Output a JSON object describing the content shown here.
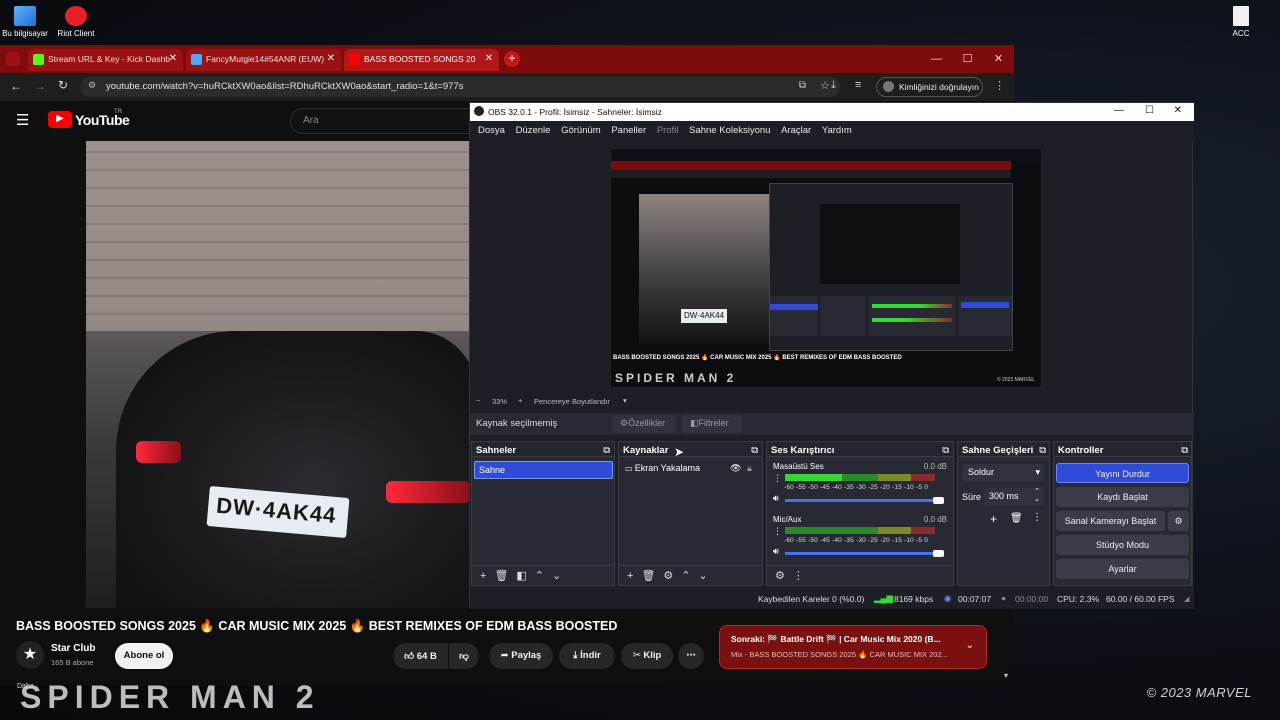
{
  "desktop": {
    "icons": [
      {
        "label": "Bu bilgisayar"
      },
      {
        "label": "Riot Client"
      },
      {
        "label": "ACC"
      }
    ],
    "wallpaper_text": "© 2023 MARVEL",
    "wallpaper_title": "SPIDER MAN 2"
  },
  "browser": {
    "tabs": [
      {
        "label": "Stream URL & Key - Kick Dashb",
        "color": "#53fc18"
      },
      {
        "label": "FancyMutgie14#54ANR (EUW)",
        "color": "#4aa8ff"
      },
      {
        "label": "BASS BOOSTED SONGS 20",
        "color": "#ff0000"
      }
    ],
    "url": "youtube.com/watch?v=huRCktXW0ao&list=RDhuRCktXW0ao&start_radio=1&t=977s",
    "profile_label": "Kimliğinizi doğrulayın"
  },
  "youtube": {
    "logo_text": "YouTube",
    "logo_sup": "TR",
    "search_placeholder": "Ara",
    "plate_text": "DW·4AK44",
    "video_title": "BASS BOOSTED SONGS 2025 🔥 CAR MUSIC MIX 2025 🔥 BEST REMIXES OF EDM BASS BOOSTED",
    "channel_name": "Star Club",
    "subscribers": "165 B abone",
    "subscribe_label": "Abone ol",
    "likes": "64 B",
    "share_label": "Paylaş",
    "download_label": "İndir",
    "clip_label": "Klip",
    "next_title": "Sonraki: 🏁 Battle Drift 🏁 | Car Music Mix 2020 (B...",
    "next_sub": "Mix - BASS BOOSTED SONGS 2025 🔥 CAR MUSIC MIX 202...",
    "corner_text": "Daha"
  },
  "obs": {
    "title": "OBS 32.0.1 - Profil: İsimsiz - Sahneler: İsimsiz",
    "menu": [
      "Dosya",
      "Düzenle",
      "Görünüm",
      "Paneller",
      "Profil",
      "Sahne Koleksiyonu",
      "Araçlar",
      "Yardım"
    ],
    "zoom": "33%",
    "fit_label": "Pencereye Boyutlandır",
    "no_source": "Kaynak seçilmemiş",
    "properties_label": "Özellikler",
    "filters_label": "Filtreler",
    "scenes": {
      "title": "Sahneler",
      "items": [
        "Sahne"
      ]
    },
    "sources": {
      "title": "Kaynaklar",
      "items": [
        "Ekran Yakalama"
      ]
    },
    "mixer": {
      "title": "Ses Karıştırıcı",
      "channels": [
        {
          "name": "Masaüstü Ses",
          "db": "0.0 dB",
          "level": 0.38
        },
        {
          "name": "Mic/Aux",
          "db": "0.0 dB",
          "level": 0.0
        }
      ],
      "ticks": "-60 -55 -50 -45 -40 -35 -30 -25 -20 -15 -10 -5 0"
    },
    "transitions": {
      "title": "Sahne Geçişleri",
      "type": "Soldur",
      "duration_label": "Süre",
      "duration": "300 ms"
    },
    "controls": {
      "title": "Kontroller",
      "stop_stream": "Yayını Durdur",
      "start_record": "Kaydı Başlat",
      "virtual_cam": "Sanal Kamerayı Başlat",
      "studio_mode": "Stüdyo Modu",
      "settings": "Ayarlar"
    },
    "status": {
      "dropped": "Kaybedilen Kareler 0 (%0.0)",
      "bitrate": "8169 kbps",
      "stream_time": "00:07:07",
      "record_time": "00:00:00",
      "cpu": "CPU: 2.3%",
      "fps": "60.00 / 60.00 FPS"
    },
    "accent": "#2f4bd8"
  }
}
